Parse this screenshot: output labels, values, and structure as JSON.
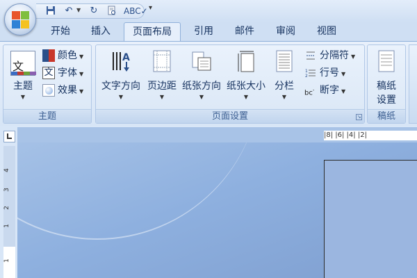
{
  "qat": {
    "items": [
      "save-icon",
      "undo-icon",
      "redo-icon",
      "print-preview-icon",
      "spelling-icon"
    ],
    "customize": "▾"
  },
  "tabs": [
    {
      "label": "开始"
    },
    {
      "label": "插入"
    },
    {
      "label": "页面布局",
      "active": true
    },
    {
      "label": "引用"
    },
    {
      "label": "邮件"
    },
    {
      "label": "审阅"
    },
    {
      "label": "视图"
    }
  ],
  "groups": {
    "theme": {
      "label": "主题",
      "themes_button": "主题",
      "colors": "颜色",
      "fonts": "字体",
      "effects": "效果"
    },
    "page_setup": {
      "label": "页面设置",
      "text_direction": "文字方向",
      "margins": "页边距",
      "orientation": "纸张方向",
      "size": "纸张大小",
      "columns": "分栏",
      "breaks": "分隔符",
      "line_numbers": "行号",
      "hyphenation": "断字"
    },
    "draft": {
      "label": "稿纸",
      "draft_settings_line1": "稿纸",
      "draft_settings_line2": "设置"
    }
  },
  "ruler": {
    "horizontal_ticks": "|8|   |6|   |4|   |2|",
    "vertical_ticks": [
      "4",
      "3",
      "2",
      "1",
      "1"
    ]
  },
  "colors": {
    "accent": "#8fb0da",
    "workspace": "#8eb0df",
    "text": "#15315e"
  }
}
